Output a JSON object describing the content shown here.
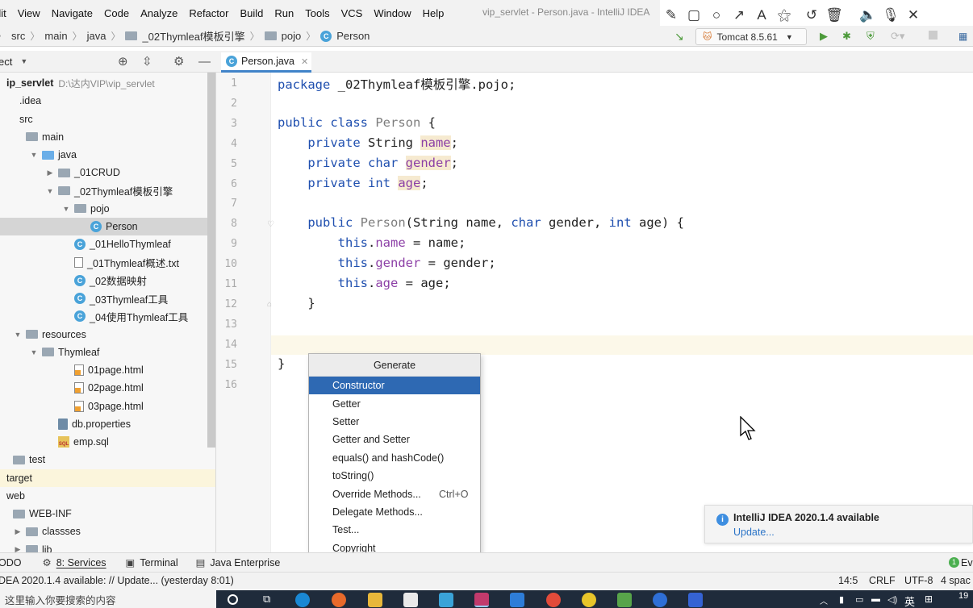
{
  "menubar": {
    "items": [
      "dit",
      "View",
      "Navigate",
      "Code",
      "Analyze",
      "Refactor",
      "Build",
      "Run",
      "Tools",
      "VCS",
      "Window",
      "Help"
    ],
    "title": "vip_servlet - Person.java - IntelliJ IDEA"
  },
  "annotation_toolbar": {
    "icons": [
      "pen-icon",
      "rectangle-icon",
      "circle-icon",
      "arrow-icon",
      "text-icon",
      "magic-wand-icon",
      "undo-icon",
      "trash-icon",
      "speaker-icon",
      "microphone-icon",
      "close-icon"
    ],
    "badge": "00"
  },
  "navbar": {
    "crumbs": [
      "src",
      "main",
      "java",
      "_02Thymleaf模板引擎",
      "pojo",
      "Person"
    ],
    "run_config": "Tomcat 8.5.61"
  },
  "project_panel": {
    "header": "ect",
    "tree": [
      {
        "label": "ip_servlet",
        "path": "D:\\达内VIP\\vip_servlet",
        "indent": 0,
        "icon": "none",
        "arrow": "",
        "bold": true
      },
      {
        "label": ".idea",
        "indent": 1,
        "icon": "none",
        "arrow": ""
      },
      {
        "label": "src",
        "indent": 1,
        "icon": "none",
        "arrow": ""
      },
      {
        "label": "main",
        "indent": 1,
        "icon": "folder",
        "arrow": ""
      },
      {
        "label": "java",
        "indent": 2,
        "icon": "folder-blue",
        "arrow": "down"
      },
      {
        "label": "_01CRUD",
        "indent": 3,
        "icon": "package",
        "arrow": "right"
      },
      {
        "label": "_02Thymleaf模板引擎",
        "indent": 3,
        "icon": "package",
        "arrow": "down"
      },
      {
        "label": "pojo",
        "indent": 4,
        "icon": "package",
        "arrow": "down"
      },
      {
        "label": "Person",
        "indent": 5,
        "icon": "class",
        "arrow": "",
        "selected": true
      },
      {
        "label": "_01HelloThymleaf",
        "indent": 4,
        "icon": "class",
        "arrow": ""
      },
      {
        "label": "_01Thymleaf概述.txt",
        "indent": 4,
        "icon": "text",
        "arrow": ""
      },
      {
        "label": "_02数据映射",
        "indent": 4,
        "icon": "class",
        "arrow": ""
      },
      {
        "label": "_03Thymleaf工具",
        "indent": 4,
        "icon": "class",
        "arrow": ""
      },
      {
        "label": "_04使用Thymleaf工具",
        "indent": 4,
        "icon": "class",
        "arrow": ""
      },
      {
        "label": "resources",
        "indent": 1,
        "icon": "folder",
        "arrow": "down"
      },
      {
        "label": "Thymleaf",
        "indent": 2,
        "icon": "folder",
        "arrow": "down"
      },
      {
        "label": "01page.html",
        "indent": 4,
        "icon": "html",
        "arrow": ""
      },
      {
        "label": "02page.html",
        "indent": 4,
        "icon": "html",
        "arrow": ""
      },
      {
        "label": "03page.html",
        "indent": 4,
        "icon": "html",
        "arrow": ""
      },
      {
        "label": "db.properties",
        "indent": 3,
        "icon": "properties",
        "arrow": ""
      },
      {
        "label": "emp.sql",
        "indent": 3,
        "icon": "sql",
        "arrow": ""
      },
      {
        "label": "test",
        "indent": 0,
        "icon": "folder",
        "arrow": ""
      },
      {
        "label": "target",
        "indent": 0,
        "icon": "none",
        "arrow": "",
        "highlight": true
      },
      {
        "label": "web",
        "indent": 0,
        "icon": "none",
        "arrow": ""
      },
      {
        "label": "WEB-INF",
        "indent": 0,
        "icon": "folder",
        "arrow": ""
      },
      {
        "label": "classses",
        "indent": 1,
        "icon": "folder",
        "arrow": "right"
      },
      {
        "label": "lib",
        "indent": 1,
        "icon": "folder",
        "arrow": "right"
      }
    ]
  },
  "editor": {
    "tab": "Person.java",
    "lines": [
      {
        "n": "1",
        "html": "<span class='kw'>package</span> _02Thymleaf模板引擎.pojo;"
      },
      {
        "n": "2",
        "html": ""
      },
      {
        "n": "3",
        "html": "<span class='kw'>public class</span> <span class='gray'>Person</span> {"
      },
      {
        "n": "4",
        "html": "    <span class='kw'>private</span> String <span class='fld fbg'>name</span>;"
      },
      {
        "n": "5",
        "html": "    <span class='kw'>private</span> <span class='kw'>char</span> <span class='fld fbg'>gender</span>;"
      },
      {
        "n": "6",
        "html": "    <span class='kw'>private</span> <span class='kw'>int</span> <span class='fld fbg'>age</span>;"
      },
      {
        "n": "7",
        "html": ""
      },
      {
        "n": "8",
        "html": "    <span class='kw'>public</span> <span class='gray'>Person</span>(String name, <span class='kw'>char</span> gender, <span class='kw'>int</span> age) {"
      },
      {
        "n": "9",
        "html": "        <span class='kw'>this</span>.<span class='fld'>name</span> = name;"
      },
      {
        "n": "10",
        "html": "        <span class='kw'>this</span>.<span class='fld'>gender</span> = gender;"
      },
      {
        "n": "11",
        "html": "        <span class='kw'>this</span>.<span class='fld'>age</span> = age;"
      },
      {
        "n": "12",
        "html": "    }"
      },
      {
        "n": "13",
        "html": ""
      },
      {
        "n": "14",
        "html": ""
      },
      {
        "n": "15",
        "html": "}"
      },
      {
        "n": "16",
        "html": ""
      }
    ]
  },
  "generate_popup": {
    "title": "Generate",
    "items": [
      {
        "label": "Constructor",
        "selected": true
      },
      {
        "label": "Getter"
      },
      {
        "label": "Setter"
      },
      {
        "label": "Getter and Setter"
      },
      {
        "label": "equals() and hashCode()"
      },
      {
        "label": "toString()"
      },
      {
        "label": "Override Methods...",
        "shortcut": "Ctrl+O"
      },
      {
        "label": "Delegate Methods..."
      },
      {
        "label": "Test..."
      },
      {
        "label": "Copyright"
      }
    ]
  },
  "notification": {
    "title": "IntelliJ IDEA 2020.1.4 available",
    "link": "Update..."
  },
  "tool_windows": {
    "todo": "ODO",
    "services": "8: Services",
    "terminal": "Terminal",
    "java_enterprise": "Java Enterprise",
    "event_log": "Ev"
  },
  "statusbar": {
    "message": "DEA 2020.1.4 available: // Update... (yesterday 8:01)",
    "position": "14:5",
    "line_sep": "CRLF",
    "encoding": "UTF-8",
    "indent": "4 spac"
  },
  "taskbar": {
    "search_placeholder": "这里输入你要搜索的内容",
    "ime": "英",
    "clock": "19"
  }
}
